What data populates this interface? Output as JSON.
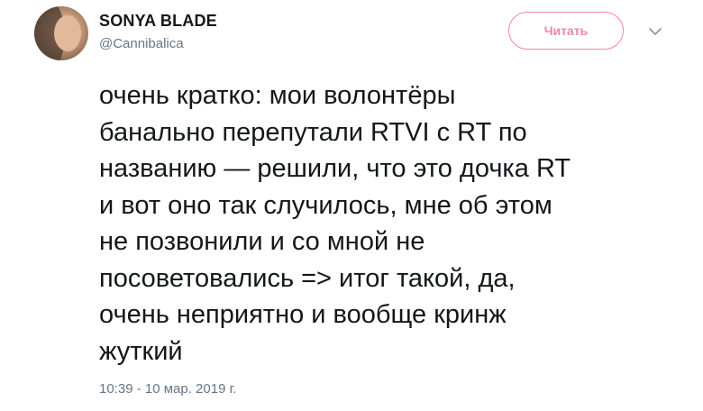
{
  "author": {
    "display_name": "SONYA BLADE",
    "handle": "@Cannibalica"
  },
  "follow_button": {
    "label": "Читать"
  },
  "tweet": {
    "lines": [
      "очень кратко: мои волонтёры",
      "банально перепутали RTVI с RT по",
      "названию — решили, что это дочка RT",
      "и вот оно так случилось, мне об этом",
      "не позвонили и со мной не",
      "посоветовались => итог такой, да,",
      "очень неприятно и вообще кринж",
      "жуткий"
    ],
    "timestamp": "10:39 - 10 мар. 2019 г."
  },
  "colors": {
    "accent": "#e0245e",
    "text": "#14171a",
    "secondary": "#657786"
  },
  "icons": {
    "menu": "chevron-down-icon"
  }
}
